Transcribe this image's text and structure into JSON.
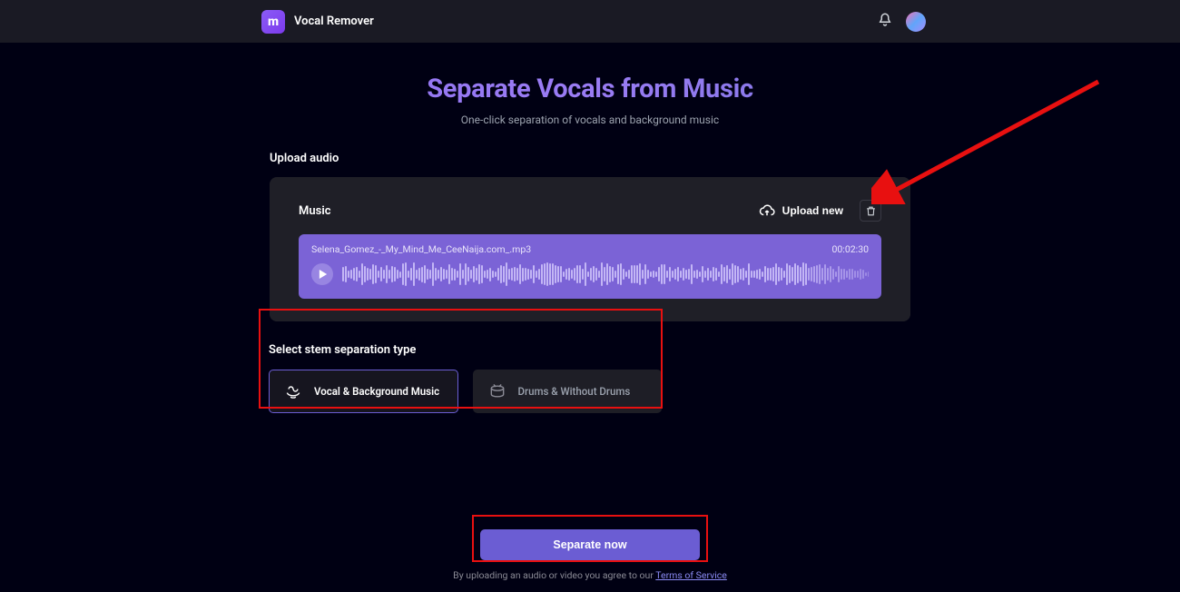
{
  "header": {
    "app_name": "Vocal Remover",
    "logo_letter": "m"
  },
  "hero": {
    "title": "Separate Vocals from Music",
    "subtitle": "One-click separation of vocals and background music"
  },
  "upload": {
    "section_label": "Upload audio",
    "card_title": "Music",
    "upload_new_label": "Upload new",
    "file_name": "Selena_Gomez_-_My_Mind_Me_CeeNaija.com_.mp3",
    "duration": "00:02:30"
  },
  "stems": {
    "section_label": "Select stem separation type",
    "option1": "Vocal & Background Music",
    "option2": "Drums & Without Drums"
  },
  "action": {
    "separate_label": "Separate now",
    "agree_prefix": "By uploading an audio or video you agree to our ",
    "tos_label": "Terms of Service"
  }
}
